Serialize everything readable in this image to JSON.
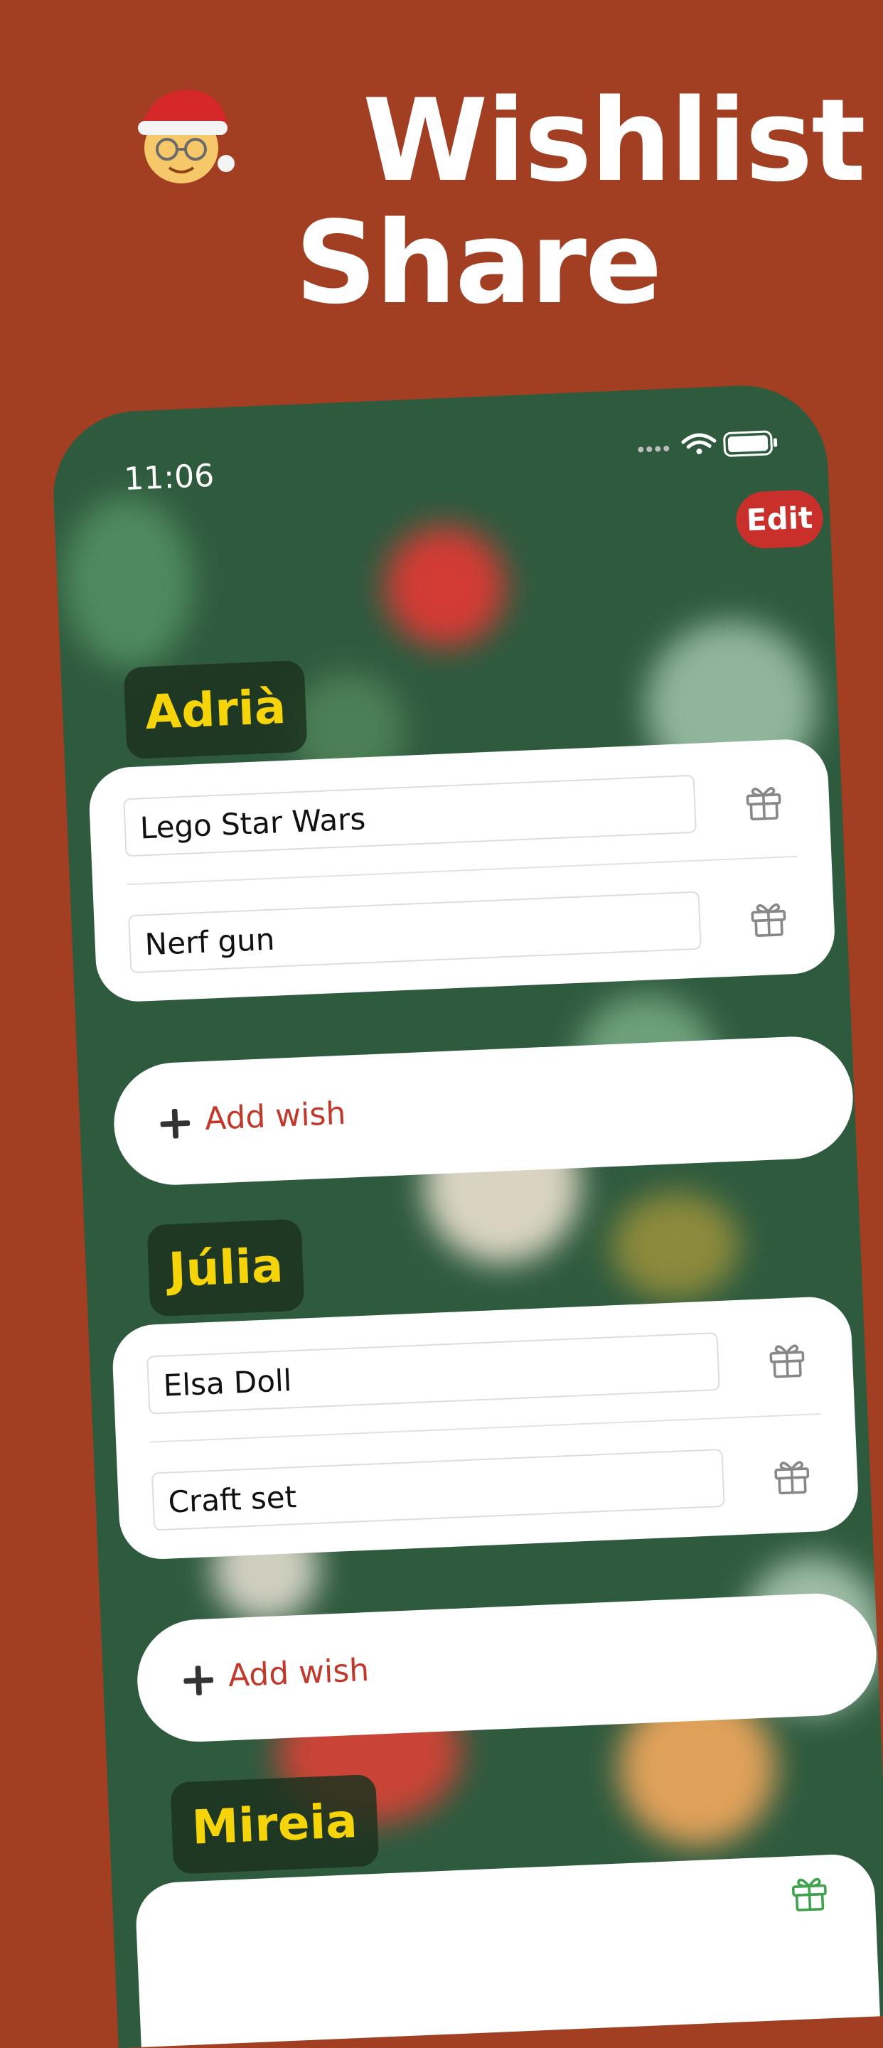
{
  "hero": {
    "title_line1": "Wishlist",
    "title_line2": "Share",
    "emoji_icon": "santa-emoji"
  },
  "status_bar": {
    "time": "11:06"
  },
  "toolbar": {
    "edit_label": "Edit"
  },
  "people": [
    {
      "name": "Adrià",
      "wishes": [
        "Lego Star Wars",
        "Nerf gun"
      ],
      "add_label": "Add wish"
    },
    {
      "name": "Júlia",
      "wishes": [
        "Elsa Doll",
        "Craft set"
      ],
      "add_label": "Add wish"
    },
    {
      "name": "Mireia",
      "wishes": [],
      "add_label": ""
    }
  ],
  "colors": {
    "page_background": "#A23E22",
    "phone_background": "#2E5A3E",
    "edit_button": "#C9302C",
    "name_text": "#F6D40A",
    "add_wish_text": "#C0392B"
  }
}
